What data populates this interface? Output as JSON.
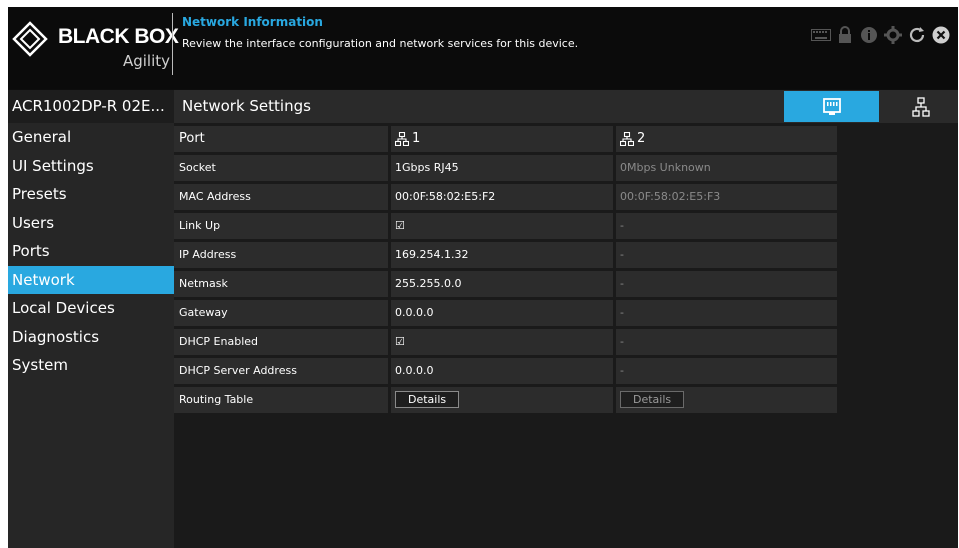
{
  "brand": {
    "name": "BLACK BOX",
    "sub": "Agility"
  },
  "header": {
    "title": "Network Information",
    "description": "Review the interface configuration and network services for this device.",
    "icons": [
      "keyboard-icon",
      "lock-icon",
      "info-icon",
      "gear-icon",
      "refresh-icon",
      "close-icon"
    ]
  },
  "sidebar": {
    "device_name": "ACR1002DP-R 02E...",
    "items": [
      {
        "label": "General"
      },
      {
        "label": "UI Settings"
      },
      {
        "label": "Presets"
      },
      {
        "label": "Users"
      },
      {
        "label": "Ports"
      },
      {
        "label": "Network",
        "active": true
      },
      {
        "label": "Local Devices"
      },
      {
        "label": "Diagnostics"
      },
      {
        "label": "System"
      }
    ]
  },
  "main": {
    "section_title": "Network Settings",
    "tabs": [
      {
        "icon": "ethernet-port-icon",
        "active": true
      },
      {
        "icon": "network-topology-icon",
        "active": false
      }
    ],
    "table": {
      "header": {
        "label": "Port",
        "port1": "1",
        "port2": "2"
      },
      "rows": [
        {
          "label": "Socket",
          "port1": "1Gbps RJ45",
          "port2": "0Mbps Unknown"
        },
        {
          "label": "MAC Address",
          "port1": "00:0F:58:02:E5:F2",
          "port2": "00:0F:58:02:E5:F3"
        },
        {
          "label": "Link Up",
          "port1": "☑",
          "port2": "-"
        },
        {
          "label": "IP Address",
          "port1": "169.254.1.32",
          "port2": "-"
        },
        {
          "label": "Netmask",
          "port1": "255.255.0.0",
          "port2": "-"
        },
        {
          "label": "Gateway",
          "port1": "0.0.0.0",
          "port2": "-"
        },
        {
          "label": "DHCP Enabled",
          "port1": "☑",
          "port2": "-"
        },
        {
          "label": "DHCP Server Address",
          "port1": "0.0.0.0",
          "port2": "-"
        }
      ],
      "routing": {
        "label": "Routing Table",
        "port1_button": "Details",
        "port2_button": "Details"
      }
    }
  },
  "colors": {
    "accent": "#29a8e0",
    "background": "#0d0d0d",
    "panel": "#262626"
  }
}
